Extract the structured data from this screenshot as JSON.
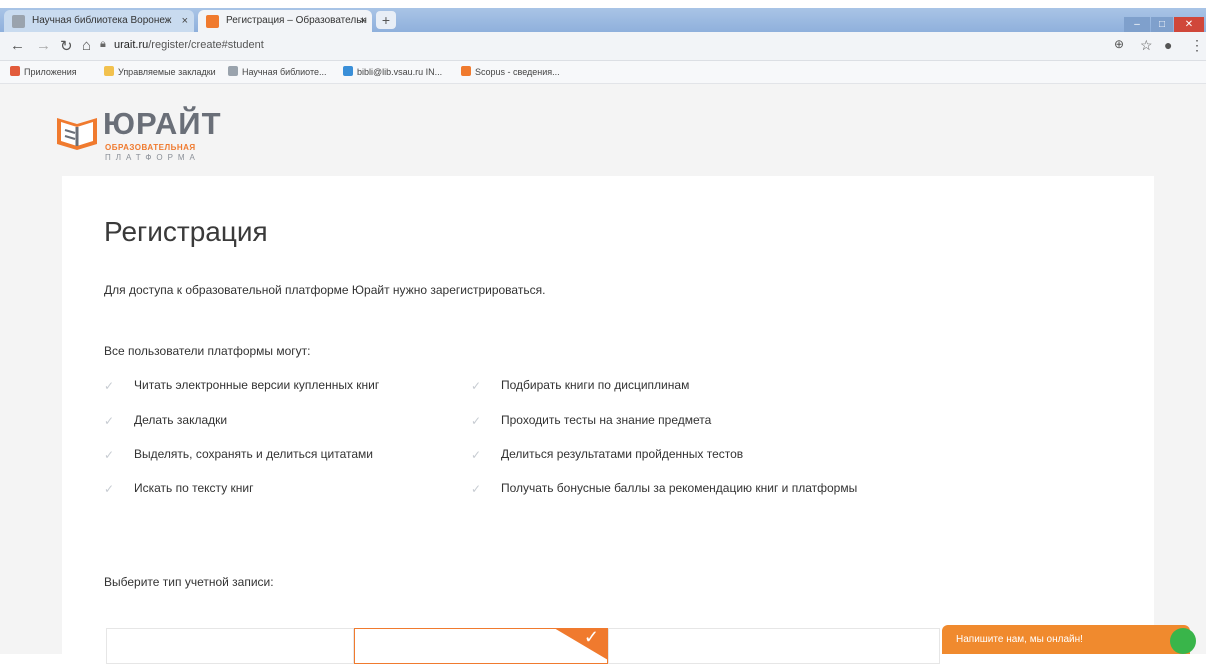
{
  "browser": {
    "tabs": [
      {
        "title": "Научная библиотека Воронеж",
        "active": false
      },
      {
        "title": "Регистрация – Образовательн",
        "active": true
      }
    ],
    "new_tab_glyph": "+",
    "close_glyph": "×",
    "url_host": "urait.ru",
    "url_path": "/register/create#student",
    "bookmarks": [
      {
        "label": "Приложения",
        "icon": "apps-grid-icon",
        "color": "#e25b3b"
      },
      {
        "label": "Управляемые закладки",
        "icon": "folder-icon",
        "color": "#f2c14e"
      },
      {
        "label": "Научная библиоте...",
        "icon": "site-icon",
        "color": "#9aa3ad"
      },
      {
        "label": "bibli@lib.vsau.ru IN...",
        "icon": "site-icon",
        "color": "#3a8fd8"
      },
      {
        "label": "Scopus - сведения...",
        "icon": "scopus-icon",
        "color": "#f07a2e"
      }
    ]
  },
  "logo": {
    "word": "ЮРАЙТ",
    "line1": "ОБРАЗОВАТЕЛЬНАЯ",
    "line2": "ПЛАТФОРМА",
    "accent": "#f07a2e"
  },
  "main": {
    "title": "Регистрация",
    "intro": "Для доступа к образовательной платформе Юрайт нужно зарегистрироваться.",
    "all_users": "Все пользователи платформы могут:",
    "features_left": [
      "Читать электронные версии купленных книг",
      "Делать закладки",
      "Выделять, сохранять и делиться цитатами",
      "Искать по тексту книг"
    ],
    "features_right": [
      "Подбирать книги по дисциплинам",
      "Проходить тесты на знание предмета",
      "Делиться результатами пройденных тестов",
      "Получать бонусные баллы за рекомендацию книг и платформы"
    ],
    "choose_account": "Выберите тип учетной записи:"
  },
  "chat": {
    "label": "Напишите нам, мы онлайн!",
    "color": "#f08a2e"
  }
}
